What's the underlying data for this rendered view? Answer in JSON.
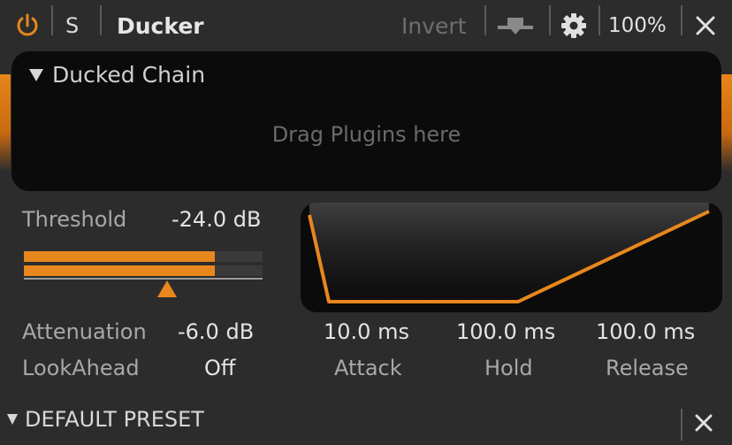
{
  "header": {
    "solo_label": "S",
    "title": "Ducker",
    "invert_label": "Invert",
    "zoom": "100%"
  },
  "chain": {
    "title": "Ducked Chain",
    "hint": "Drag Plugins here"
  },
  "threshold": {
    "label": "Threshold",
    "value": "-24.0 dB",
    "meter_level_fraction": 0.8,
    "marker_fraction": 0.6
  },
  "attenuation": {
    "label": "Attenuation",
    "value": "-6.0 dB"
  },
  "lookahead": {
    "label": "LookAhead",
    "value": "Off"
  },
  "envelope": {
    "attack": {
      "label": "Attack",
      "value": "10.0 ms"
    },
    "hold": {
      "label": "Hold",
      "value": "100.0 ms"
    },
    "release": {
      "label": "Release",
      "value": "100.0 ms"
    }
  },
  "footer": {
    "preset_name": "DEFAULT PRESET"
  },
  "colors": {
    "accent": "#e8871e",
    "background": "#2c2c2c",
    "panel": "#0b0b0b"
  },
  "icons": [
    "power-icon",
    "route-icon",
    "gear-icon",
    "close-icon"
  ]
}
